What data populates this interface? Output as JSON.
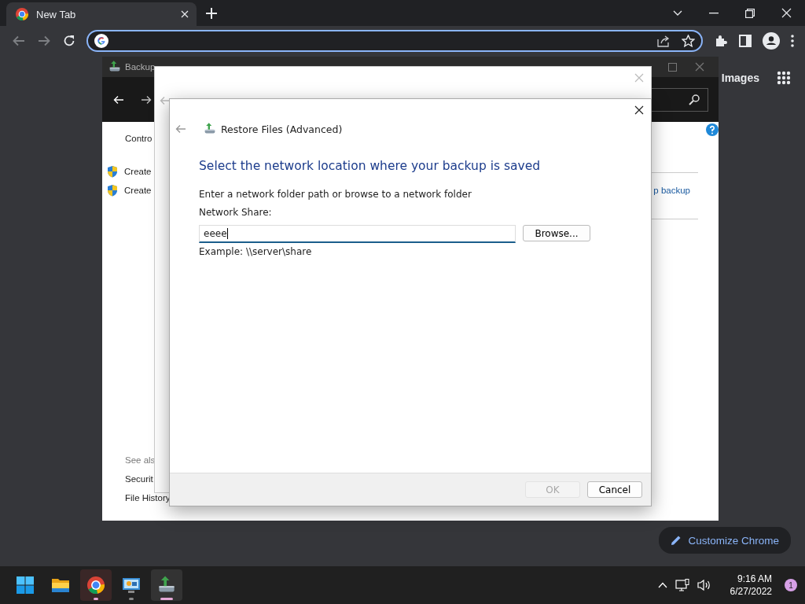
{
  "browser": {
    "tab": {
      "title": "New Tab"
    },
    "images_link": "Images",
    "customize_button": "Customize Chrome"
  },
  "backup_window": {
    "title": "Backup",
    "sidebar_top": [
      {
        "text": "Contro",
        "kind": "link"
      },
      {
        "text": "Create",
        "kind": "shield"
      },
      {
        "text": "Create",
        "kind": "shield"
      }
    ],
    "see_also": "See als",
    "see_also_links": [
      "Securit",
      "File History"
    ],
    "right_link": "p backup"
  },
  "dialog": {
    "title": "Restore Files (Advanced)",
    "heading": "Select the network location where your backup is saved",
    "instruction": "Enter a network folder path or browse to a network folder",
    "field_label": "Network Share:",
    "field_value": "eeee",
    "browse_button": "Browse...",
    "example": "Example: \\\\server\\share",
    "buttons": [
      {
        "label": "OK",
        "disabled": true
      },
      {
        "label": "Cancel",
        "disabled": false
      }
    ]
  },
  "taskbar": {
    "apps": [
      {
        "kind": "start",
        "running": false,
        "selected": false
      },
      {
        "kind": "explorer",
        "running": false,
        "selected": false
      },
      {
        "kind": "chrome",
        "running": true,
        "selected": true
      },
      {
        "kind": "control-panel",
        "running": true,
        "selected": false
      },
      {
        "kind": "backup",
        "running": true,
        "selected": true
      }
    ],
    "time": "9:16 AM",
    "date": "6/27/2022",
    "notification_count": "1"
  }
}
